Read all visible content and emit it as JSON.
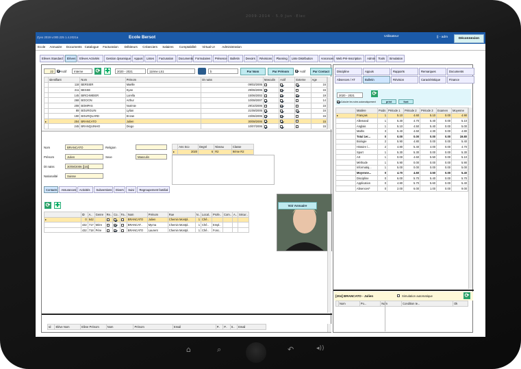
{
  "device": {
    "camera_text": "2009·2014 · 5.0 Jun ·Elec"
  },
  "window": {
    "app_version": "Zyvo 2019 v.000.225 1.4.2021a",
    "title": "Ecole Bersot",
    "user_label": "Utilisateur",
    "user_name": "|| - adm",
    "disconnect": "Déconnexion"
  },
  "menu": [
    "Ecole",
    "Annuaire",
    "Documents",
    "Catalogue",
    "Facturation",
    "Débiteurs",
    "Créanciers",
    "Salaires",
    "Comptabilité",
    "Virtual UI",
    "Administration"
  ],
  "tabs": [
    "Elèves Standard",
    "Elèves",
    "Elèves Activités",
    "Gestion dynamique",
    "Appuis",
    "Listes",
    "Facturation",
    "Documents",
    "Formulaires",
    "Présence",
    "Bulletin",
    "Devoirs",
    "Révisions",
    "Planning",
    "Liste Distribution",
    "Annonces",
    "Web Pré-Inscription",
    "Admin",
    "Tools",
    "Simulation"
  ],
  "filters": {
    "count": "22",
    "actif_label": "Actif",
    "mode": "Interne",
    "year": "2020 - 2021",
    "class": "11ème LS1",
    "search": "b",
    "btn_par_nom": "Par Nom",
    "btn_par_prenom": "Par Prénom",
    "btn_par_contact": "Par Contact",
    "actif2_label": "Actif"
  },
  "students": {
    "headers": [
      "Identifiant",
      "Nom",
      "Prénom",
      "Dt naiss",
      "Masculin",
      "Actif",
      "Externe",
      "Age"
    ],
    "rows": [
      {
        "id": "118",
        "nom": "BERSIER",
        "prenom": "Maëlle",
        "dt": "09/02/2005",
        "m": false,
        "a": true,
        "e": true,
        "age": "16"
      },
      {
        "id": "211",
        "nom": "BESSE",
        "prenom": "Kyan",
        "dt": "29/06/2006",
        "m": true,
        "a": true,
        "e": false,
        "age": "15"
      },
      {
        "id": "145",
        "nom": "BIRCHMEIER",
        "prenom": "Lorella",
        "dt": "15/06/2002",
        "m": false,
        "a": true,
        "e": true,
        "age": "19"
      },
      {
        "id": "268",
        "nom": "BOCION",
        "prenom": "Arthur",
        "dt": "10/08/2007",
        "m": true,
        "a": true,
        "e": false,
        "age": "14"
      },
      {
        "id": "208",
        "nom": "BOMPAS",
        "prenom": "Noémie",
        "dt": "29/10/2006",
        "m": false,
        "a": true,
        "e": false,
        "age": "15"
      },
      {
        "id": "89",
        "nom": "BOURGUIN",
        "prenom": "Lylian",
        "dt": "21/08/2005",
        "m": true,
        "a": true,
        "e": true,
        "age": "16"
      },
      {
        "id": "190",
        "nom": "BOURQUARD",
        "prenom": "Enzan",
        "dt": "23/06/2006",
        "m": true,
        "a": true,
        "e": false,
        "age": "15"
      },
      {
        "id": "204",
        "nom": "BRANCATO",
        "prenom": "Julien",
        "dt": "30/08/2006",
        "m": true,
        "a": true,
        "e": false,
        "age": "15",
        "sel": true
      },
      {
        "id": "245",
        "nom": "BRANQUINHO",
        "prenom": "Diogo",
        "dt": "10/07/2006",
        "m": true,
        "a": true,
        "e": false,
        "age": "15"
      }
    ]
  },
  "detail": {
    "nom_label": "Nom",
    "nom": "BRANCATO",
    "prenom_label": "Prénom",
    "prenom": "Julien",
    "dtnaiss_label": "Dt naiss",
    "dtnaiss": "30/08/2006  [[15]]",
    "nationalite_label": "Nationalité",
    "nationalite": "Suisse",
    "religion_label": "Religion",
    "sexe_label": "Sexe",
    "sexe": "Masculin"
  },
  "classes": {
    "headers": [
      "Ans Sco",
      "Degré",
      "Niveau",
      "Classe"
    ],
    "rows": [
      {
        "an": "2020",
        "degre": "6",
        "niveau": "R2",
        "classe": "9ème R2"
      }
    ]
  },
  "contact_tabs": [
    "Contacts",
    "Assurances",
    "Activités",
    "Subventions",
    "Divers",
    "Suivi",
    "Regroupement familial"
  ],
  "contacts": {
    "btn_annuaire": "Voir Annuaire",
    "headers": [
      "ID",
      "A..",
      "Genre",
      "Re..",
      "Co..",
      "Fa..",
      "Nom",
      "Prénom",
      "Rue",
      "N..",
      "Local..",
      "Profe..",
      "Com..",
      "A..",
      "Sécur.."
    ],
    "rows": [
      {
        "id": "0",
        "a": "642",
        "genre": "",
        "nom": "BRANCATO",
        "prenom": "Julien",
        "rue": "Chemin Montpl..",
        "n": "1",
        "loc": "Chê..",
        "prof": "",
        "sel": true
      },
      {
        "id": "432",
        "a": "717",
        "genre": "Mère",
        "nom": "BRANCAT..",
        "prenom": "Myrna",
        "rue": "Chemin Montpl..",
        "n": "1",
        "loc": "Chê..",
        "prof": "Empl.."
      },
      {
        "id": "432",
        "a": "718",
        "genre": "Père",
        "nom": "BRANCATO",
        "prenom": "Laurent",
        "rue": "Chemin Montpl..",
        "n": "1",
        "loc": "Chê..",
        "prof": "Fonc.."
      }
    ]
  },
  "siblings": {
    "headers": [
      "Id",
      "Elève Nom",
      "Elève Prénom",
      "Nom",
      "Prénom",
      "Email",
      "P..",
      "P..",
      "S..",
      "Email"
    ]
  },
  "right": {
    "tabs_row1": [
      "Discipline",
      "Appuis",
      "Rapports",
      "Remarques",
      "Documents"
    ],
    "tabs_row2": [
      "Absences / AT",
      "Bulletin",
      "Révision",
      "Caractéristique",
      "Finance"
    ],
    "year": "2020 - 2021",
    "auto_calc_label": "Calculer les notes automatiquement",
    "btn_print": "print",
    "btn_font": "font",
    "grades_headers": [
      "Matière",
      "Poids",
      "Période 1",
      "Période 2",
      "Période 3",
      "Examen",
      "Moyenne"
    ],
    "grades": [
      {
        "m": "Français",
        "p": "1",
        "p1": "5.10",
        "p2": "4.60",
        "p3": "5.10",
        "ex": "0.00",
        "moy": "4.90",
        "sel": true
      },
      {
        "m": "Allemand",
        "p": "1",
        "p1": "5.30",
        "p2": "4.70",
        "p3": "5.40",
        "ex": "0.00",
        "moy": "5.10"
      },
      {
        "m": "Anglais",
        "p": "1",
        "p1": "5.10",
        "p2": "4.50",
        "p3": "5.40",
        "ex": "0.00",
        "moy": "5.00"
      },
      {
        "m": "Maths",
        "p": "3",
        "p1": "5.40",
        "p2": "4.60",
        "p3": "4.30",
        "ex": "0.00",
        "moy": "4.80"
      },
      {
        "m": "Total 1er...",
        "p": "0",
        "p1": "0.00",
        "p2": "0.00",
        "p3": "0.00",
        "ex": "0.00",
        "moy": "19.80",
        "bold": true
      },
      {
        "m": "Biologie",
        "p": "2",
        "p1": "5.90",
        "p2": "4.80",
        "p3": "0.00",
        "ex": "0.00",
        "moy": "5.40"
      },
      {
        "m": "Histoire /...",
        "p": "2",
        "p1": "4.80",
        "p2": "5.40",
        "p3": "4.00",
        "ex": "0.00",
        "moy": "4.70"
      },
      {
        "m": "Sport",
        "p": "1",
        "p1": "5.30",
        "p2": "5.30",
        "p3": "0.00",
        "ex": "0.00",
        "moy": "5.30"
      },
      {
        "m": "Art",
        "p": "1",
        "p1": "0.00",
        "p2": "4.60",
        "p3": "5.50",
        "ex": "0.00",
        "moy": "5.10"
      },
      {
        "m": "Méthode",
        "p": "1",
        "p1": "5.90",
        "p2": "0.00",
        "p3": "0.00",
        "ex": "0.00",
        "moy": "5.90"
      },
      {
        "m": "Informatiq...",
        "p": "1",
        "p1": "5.00",
        "p2": "0.00",
        "p3": "0.00",
        "ex": "0.00",
        "moy": "5.00"
      },
      {
        "m": "Moyenne...",
        "p": "0",
        "p1": "4.70",
        "p2": "4.60",
        "p3": "3.50",
        "ex": "0.00",
        "moy": "5.40",
        "bold": true
      },
      {
        "m": "Discipline",
        "p": "0",
        "p1": "6.00",
        "p2": "5.70",
        "p3": "5.40",
        "ex": "0.00",
        "moy": "5.70"
      },
      {
        "m": "Application",
        "p": "0",
        "p1": "4.80",
        "p2": "5.70",
        "p3": "5.60",
        "ex": "0.00",
        "moy": "5.40"
      },
      {
        "m": "Absences*",
        "p": "0",
        "p1": "2.00",
        "p2": "6.00",
        "p3": "1.00",
        "ex": "0.00",
        "moy": "9.00"
      }
    ],
    "sim_title": "[204] BRANCATO - Julien",
    "sim_label": "Simulation automatique",
    "sim_headers": [
      "Nom",
      "Po...",
      "Nom",
      "Condition te...",
      "Ok"
    ]
  }
}
